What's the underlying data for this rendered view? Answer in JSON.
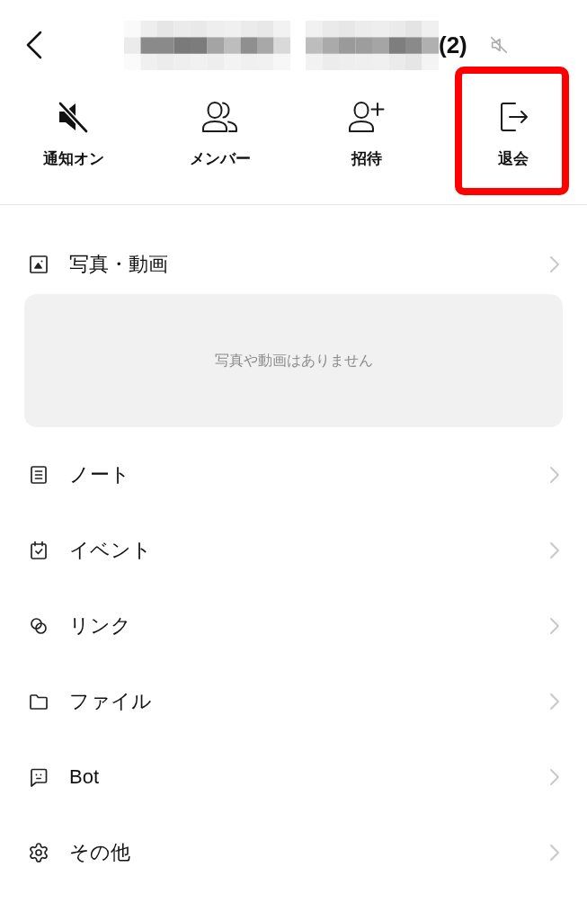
{
  "header": {
    "member_count": "(2)"
  },
  "actions": [
    {
      "label": "通知オン",
      "highlighted": false
    },
    {
      "label": "メンバー",
      "highlighted": false
    },
    {
      "label": "招待",
      "highlighted": false
    },
    {
      "label": "退会",
      "highlighted": true
    }
  ],
  "sections": [
    {
      "label": "写真・動画",
      "empty_message": "写真や動画はありません"
    },
    {
      "label": "ノート"
    },
    {
      "label": "イベント"
    },
    {
      "label": "リンク"
    },
    {
      "label": "ファイル"
    },
    {
      "label": "Bot"
    },
    {
      "label": "その他"
    }
  ]
}
